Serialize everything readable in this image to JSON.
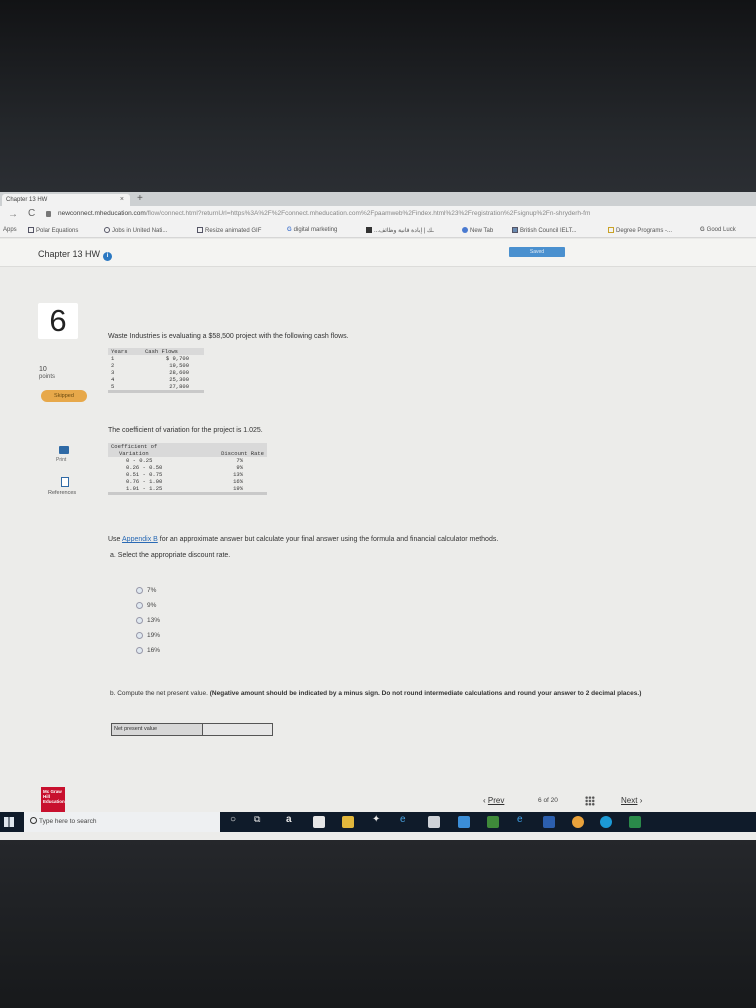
{
  "browser": {
    "tab_title": "Chapter 13 HW",
    "tab_close": "×",
    "new_tab": "+",
    "url_host": "newconnect.mheducation.com",
    "url_path": "/flow/connect.html?returnUrl=https%3A%2F%2Fconnect.mheducation.com%2Fpaamweb%2Findex.html%23%2Fregistration%2Fsignup%2Fn-shryderh-fm",
    "bookmarks": [
      "Apps",
      "Polar Equations",
      "Jobs in United Nati...",
      "Resize animated GIF",
      "digital marketing",
      "...ـك | إبادة قانية وظائف",
      "New Tab",
      "British Council IELT...",
      "Degree Programs -...",
      "Good Luck"
    ]
  },
  "header": {
    "chapter_title": "Chapter 13 HW",
    "info_icon": "i",
    "saved_label": "Saved"
  },
  "sidebar": {
    "question_number": "6",
    "points_value": "10",
    "points_label": "points",
    "status_badge": "Skipped",
    "print_label": "Print",
    "references_label": "References"
  },
  "question": {
    "intro": "Waste Industries is evaluating a $58,500 project with the following cash flows.",
    "cash_flows": {
      "headers": [
        "Years",
        "Cash Flows"
      ],
      "rows": [
        [
          "1",
          "$ 9,700"
        ],
        [
          "2",
          "19,500"
        ],
        [
          "3",
          "28,600"
        ],
        [
          "4",
          "25,300"
        ],
        [
          "5",
          "27,800"
        ]
      ]
    },
    "cv_text": "The coefficient of variation for the project is 1.025.",
    "discount_table": {
      "header_line1": "Coefficient of",
      "header_line2": "Variation",
      "header_rate": "Discount Rate",
      "rows": [
        [
          "0 - 0.25",
          "7%"
        ],
        [
          "0.26 - 0.50",
          "9%"
        ],
        [
          "0.51 - 0.75",
          "13%"
        ],
        [
          "0.76 - 1.00",
          "16%"
        ],
        [
          "1.01 - 1.25",
          "19%"
        ]
      ]
    },
    "appendix_prefix": "Use ",
    "appendix_link": "Appendix B",
    "appendix_suffix": " for an approximate answer but calculate your final answer using the formula and financial calculator methods.",
    "part_a": "a. Select the appropriate discount rate.",
    "options": [
      "7%",
      "9%",
      "13%",
      "19%",
      "16%"
    ],
    "part_b_intro": "b. Compute the net present value.",
    "part_b_bold": "(Negative amount should be indicated by a minus sign. Do not round intermediate calculations and round your answer to 2 decimal places.)",
    "npv_label": "Net present value",
    "npv_value": ""
  },
  "footer": {
    "logo_text": "Mc Graw Hill Education",
    "prev_label": "Prev",
    "page_current": "6",
    "page_of": "of",
    "page_total": "20",
    "next_label": "Next"
  },
  "taskbar": {
    "search_placeholder": "Type here to search",
    "icons": [
      "task-view-icon",
      "amazon-icon",
      "store-icon",
      "file-explorer-icon",
      "dropbox-icon",
      "edge-icon",
      "calculator-icon",
      "mail-icon",
      "tripadvisor-icon",
      "ie-icon",
      "word-icon",
      "chrome-icon",
      "skype-icon",
      "excel-icon"
    ]
  }
}
